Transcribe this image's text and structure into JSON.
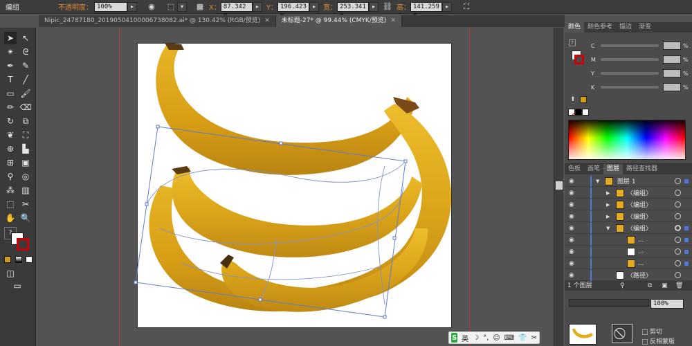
{
  "control_bar": {
    "object_type": "编组",
    "opacity_label": "不透明度：",
    "opacity_value": "100%",
    "x_label": "X：",
    "x_value": "87.342 m",
    "y_label": "Y：",
    "y_value": "196.423 m",
    "width_label": "宽：",
    "width_value": "253.341 m",
    "height_label": "高：",
    "height_value": "141.259 m"
  },
  "document_tabs": [
    {
      "label": "Nipic_24787180_20190504100006738082.ai* @ 130.42% (RGB/预览)",
      "active": false
    },
    {
      "label": "未标题-27* @ 99.44% (CMYK/预览)",
      "active": true
    }
  ],
  "color_panel": {
    "tabs": [
      "颜色",
      "颜色参考",
      "描边",
      "渐变"
    ],
    "channels": [
      {
        "label": "C",
        "unit": "%"
      },
      {
        "label": "M",
        "unit": "%"
      },
      {
        "label": "Y",
        "unit": "%"
      },
      {
        "label": "K",
        "unit": "%"
      }
    ],
    "fill_color": "#d4a017"
  },
  "layers_panel": {
    "tabs": [
      "色板",
      "画笔",
      "图层",
      "路径查找器"
    ],
    "rows": [
      {
        "name": "图层 1",
        "level": 0,
        "expanded": true
      },
      {
        "name": "〈编组〉",
        "level": 1,
        "expanded": false
      },
      {
        "name": "〈编组〉",
        "level": 1,
        "expanded": false
      },
      {
        "name": "〈编组〉",
        "level": 1,
        "expanded": false
      },
      {
        "name": "〈编组〉",
        "level": 1,
        "expanded": true
      },
      {
        "name": "...",
        "level": 2,
        "expanded": false
      },
      {
        "name": "...",
        "level": 2,
        "expanded": false
      },
      {
        "name": "...",
        "level": 2,
        "expanded": false
      },
      {
        "name": "〈路径〉",
        "level": 1,
        "expanded": false
      }
    ],
    "footer": "1 个图层"
  },
  "bottom_panel": {
    "opacity_value": "100%",
    "clip_label": "剪切",
    "invert_label": "反相蒙版"
  },
  "ime": {
    "logo": "S",
    "mode": "英"
  },
  "colors": {
    "banana": "#e3ac1c",
    "guide": "#b53a3a",
    "selection": "#5b7bd1"
  }
}
